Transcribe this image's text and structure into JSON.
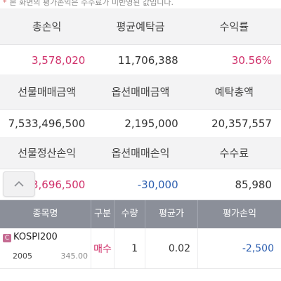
{
  "note": {
    "star": "*",
    "text": "본 화면의 평가손익은 수수료가 미반영된 값입니다."
  },
  "summary": {
    "row1": {
      "labels": [
        "총손익",
        "평균예탁금",
        "수익률"
      ],
      "values": [
        "3,578,020",
        "11,706,388",
        "30.56%"
      ]
    },
    "row2": {
      "labels": [
        "선물매매금액",
        "옵션매매금액",
        "예탁총액"
      ],
      "values": [
        "7,533,496,500",
        "2,195,000",
        "20,357,557"
      ]
    },
    "row3": {
      "labels": [
        "선물정산손익",
        "옵션매매손익",
        "수수료"
      ],
      "values": [
        "3,696,500",
        "-30,000",
        "85,980"
      ]
    }
  },
  "collapse_button": {
    "icon": "chevron-up-icon"
  },
  "positions_table": {
    "headers": [
      "종목명",
      "구분",
      "수량",
      "평균가",
      "평가손익"
    ],
    "rows": [
      {
        "badge": "C",
        "name": "KOSPI200",
        "code": "2005",
        "price": "345.00",
        "type": "매수",
        "qty": "1",
        "avg_price": "0.02",
        "pnl": "-2,500"
      }
    ]
  },
  "colors": {
    "positive": "#d0306a",
    "negative": "#2d5fb0",
    "table_header": "#8b8f99"
  }
}
